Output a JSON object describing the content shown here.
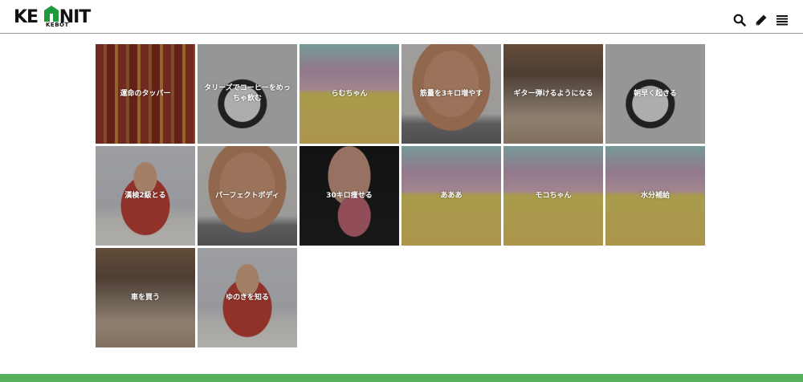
{
  "header": {
    "logo_text": "KEBOT",
    "logo_letters": "KE    NIT",
    "icons": [
      "search-icon",
      "pencil-icon",
      "menu-icon"
    ]
  },
  "tiles": [
    {
      "label": "運命のタッパー"
    },
    {
      "label": "タリーズでコーヒーをめっちゃ飲む"
    },
    {
      "label": "らむちゃん"
    },
    {
      "label": "筋量を3キロ増やす"
    },
    {
      "label": "ギター弾けるようになる"
    },
    {
      "label": "朝早く起きる"
    },
    {
      "label": "漢検2級とる"
    },
    {
      "label": "パーフェクトボディ"
    },
    {
      "label": "30キロ痩せる"
    },
    {
      "label": "あああ"
    },
    {
      "label": "モコちゃん"
    },
    {
      "label": "水分補給"
    },
    {
      "label": "車を買う"
    },
    {
      "label": "ゆのきを知る"
    }
  ],
  "colors": {
    "footer": "#57b05e",
    "header_border": "#9a9a9a"
  }
}
